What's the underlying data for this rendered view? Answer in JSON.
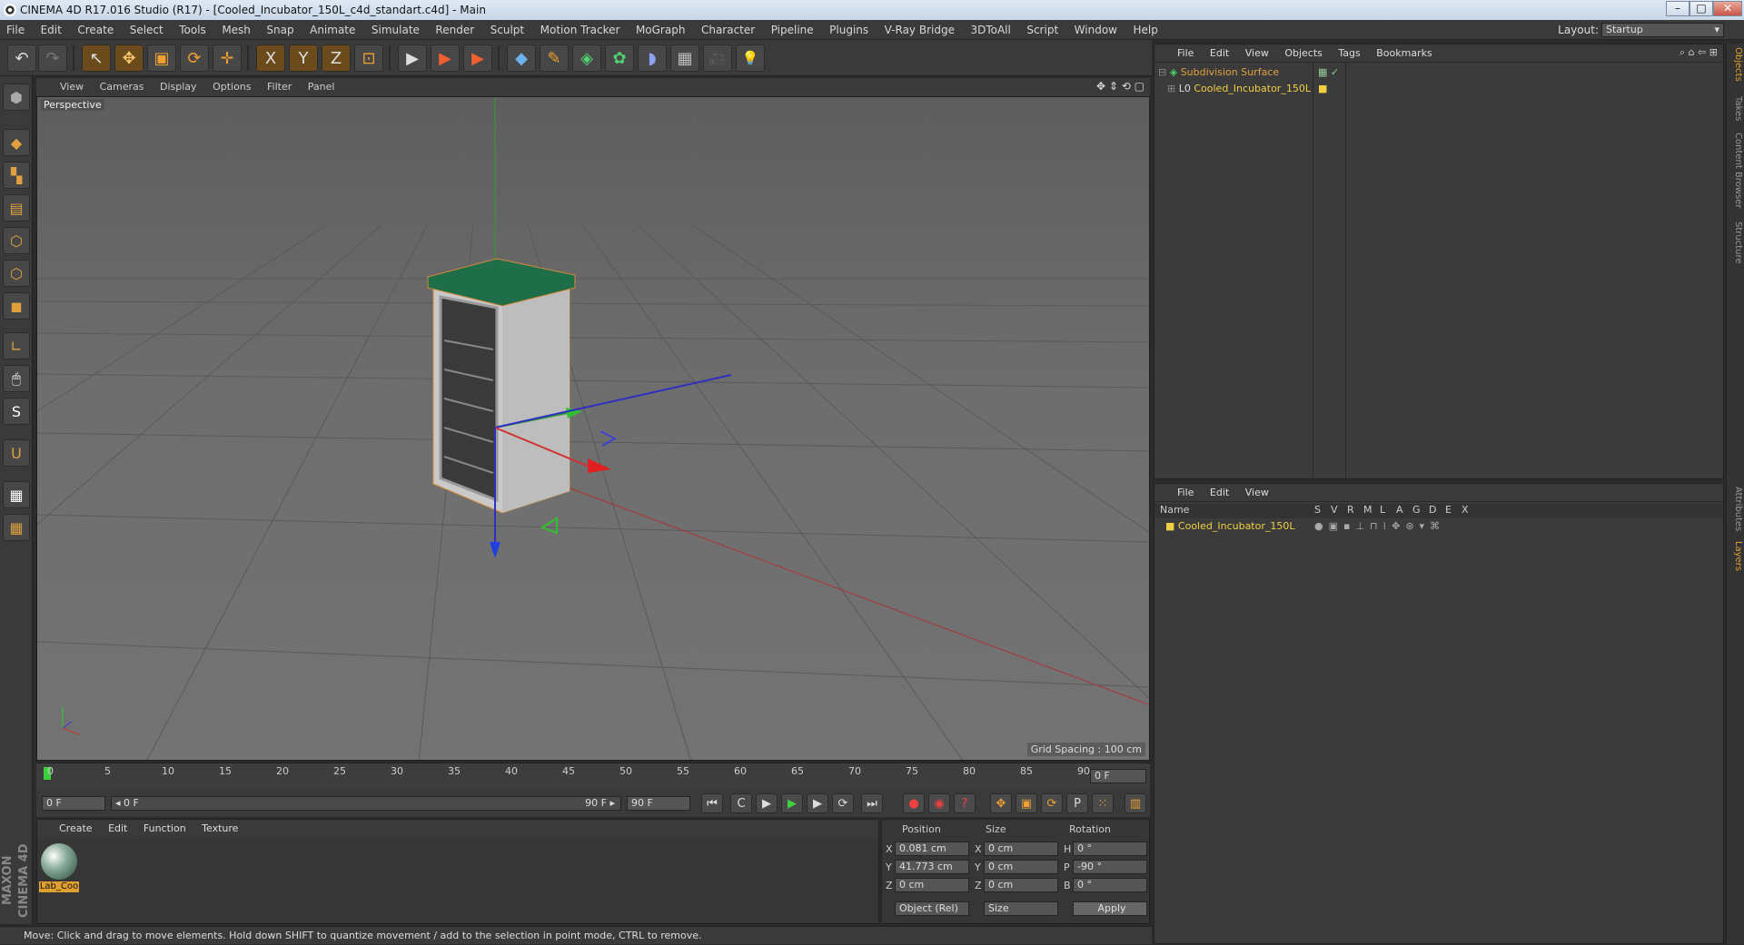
{
  "window": {
    "title": "CINEMA 4D R17.016 Studio (R17) - [Cooled_Incubator_150L_c4d_standart.c4d] - Main",
    "minimize": "–",
    "maximize": "□",
    "close": "✕"
  },
  "menubar": [
    "File",
    "Edit",
    "Create",
    "Select",
    "Tools",
    "Mesh",
    "Snap",
    "Animate",
    "Simulate",
    "Render",
    "Sculpt",
    "Motion Tracker",
    "MoGraph",
    "Character",
    "Pipeline",
    "Plugins",
    "V-Ray Bridge",
    "3DToAll",
    "Script",
    "Window",
    "Help"
  ],
  "layout": {
    "label": "Layout:",
    "value": "Startup"
  },
  "toolbar_icons": {
    "undo": "↶",
    "redo": "↷",
    "select": "↖",
    "move": "✥",
    "scale": "▣",
    "rotate": "⟳",
    "live": "✛",
    "x": "X",
    "y": "Y",
    "z": "Z",
    "coord": "⊡",
    "render1": "▶",
    "render2": "▶",
    "render3": "▶",
    "cube": "◆",
    "pen": "✎",
    "subdiv": "◈",
    "array": "✿",
    "deform": "◗",
    "floor": "▦",
    "camera": "🎥",
    "light": "💡"
  },
  "viewport": {
    "menu": [
      "View",
      "Cameras",
      "Display",
      "Options",
      "Filter",
      "Panel"
    ],
    "label": "Perspective",
    "grid_spacing": "Grid Spacing : 100 cm",
    "nav_icons": "✥ ⇕ ⟲ ▢"
  },
  "timeline": {
    "ticks": [
      "0",
      "5",
      "10",
      "15",
      "20",
      "25",
      "30",
      "35",
      "40",
      "45",
      "50",
      "55",
      "60",
      "65",
      "70",
      "75",
      "80",
      "85",
      "90"
    ],
    "current_frame": "0 F"
  },
  "transport": {
    "start": "0 F",
    "range_start": "◂ 0 F",
    "range_end": "90 F ▸",
    "end": "90 F",
    "icons": {
      "first": "⏮",
      "loop": "C",
      "prev": "◀",
      "play": "▶",
      "next": "▶",
      "rec": "⟳",
      "last": "⏭"
    }
  },
  "materials": {
    "menu": [
      "Create",
      "Edit",
      "Function",
      "Texture"
    ],
    "items": [
      {
        "label": "Lab_Coo"
      }
    ]
  },
  "coords": {
    "headers": {
      "position": "Position",
      "size": "Size",
      "rotation": "Rotation"
    },
    "rows": [
      {
        "axis": "X",
        "pos": "0.081 cm",
        "size_axis": "X",
        "size": "0 cm",
        "rot_axis": "H",
        "rot": "0 °"
      },
      {
        "axis": "Y",
        "pos": "41.773 cm",
        "size_axis": "Y",
        "size": "0 cm",
        "rot_axis": "P",
        "rot": "-90 °"
      },
      {
        "axis": "Z",
        "pos": "0 cm",
        "size_axis": "Z",
        "size": "0 cm",
        "rot_axis": "B",
        "rot": "0 °"
      }
    ],
    "mode": "Object (Rel)",
    "size_mode": "Size",
    "apply": "Apply"
  },
  "statusbar": "Move: Click and drag to move elements. Hold down SHIFT to quantize movement / add to the selection in point mode, CTRL to remove.",
  "objects_manager": {
    "menu": [
      "File",
      "Edit",
      "View",
      "Objects",
      "Tags",
      "Bookmarks"
    ],
    "items": [
      {
        "name": "Subdivision Surface",
        "color": "#e0a040"
      },
      {
        "name": "Cooled_Incubator_150L",
        "color": "#f0d040"
      }
    ]
  },
  "layers_manager": {
    "menu": [
      "File",
      "Edit",
      "View"
    ],
    "columns": [
      "Name",
      "S",
      "V",
      "R",
      "M",
      "L",
      "A",
      "G",
      "D",
      "E",
      "X"
    ],
    "items": [
      {
        "name": "Cooled_Incubator_150L",
        "color": "#f0d040"
      }
    ]
  },
  "right_tabs": [
    "Objects",
    "Takes",
    "Content Browser",
    "Structure",
    "Attributes",
    "Layers"
  ],
  "maxon": "MAXON CINEMA 4D"
}
